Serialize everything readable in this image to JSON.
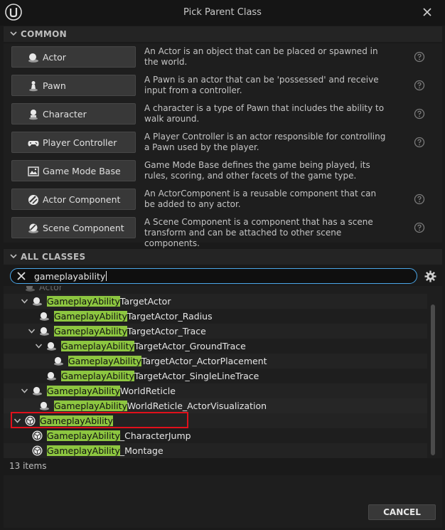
{
  "window": {
    "title": "Pick Parent Class"
  },
  "common": {
    "header": "COMMON",
    "items": [
      {
        "label": "Actor",
        "icon": "actor-icon",
        "description": "An Actor is an object that can be placed or spawned in the world.",
        "has_help": true
      },
      {
        "label": "Pawn",
        "icon": "pawn-icon",
        "description": "A Pawn is an actor that can be 'possessed' and receive input from a controller.",
        "has_help": true
      },
      {
        "label": "Character",
        "icon": "character-icon",
        "description": "A character is a type of Pawn that includes the ability to walk around.",
        "has_help": true
      },
      {
        "label": "Player Controller",
        "icon": "gamepad-icon",
        "description": "A Player Controller is an actor responsible for controlling a Pawn used by the player.",
        "has_help": true
      },
      {
        "label": "Game Mode Base",
        "icon": "game-mode-icon",
        "description": "Game Mode Base defines the game being played, its rules, scoring, and other facets of the game type.",
        "has_help": false
      },
      {
        "label": "Actor Component",
        "icon": "actor-component-icon",
        "description": "An ActorComponent is a reusable component that can be added to any actor.",
        "has_help": true
      },
      {
        "label": "Scene Component",
        "icon": "scene-component-icon",
        "description": "A Scene Component is a component that has a scene transform and can be attached to other scene components.",
        "has_help": true
      }
    ]
  },
  "all_classes": {
    "header": "ALL CLASSES",
    "search_value": "gameplayability",
    "tree": [
      {
        "match": "",
        "rest": "Actor",
        "icon": "actor-icon",
        "faded": true
      },
      {
        "match": "GameplayAbility",
        "rest": "TargetActor",
        "icon": "actor-icon",
        "expanded": true
      },
      {
        "match": "GameplayAbility",
        "rest": "TargetActor_Radius",
        "icon": "actor-icon"
      },
      {
        "match": "GameplayAbility",
        "rest": "TargetActor_Trace",
        "icon": "actor-icon",
        "expanded": true
      },
      {
        "match": "GameplayAbility",
        "rest": "TargetActor_GroundTrace",
        "icon": "actor-icon",
        "expanded": true
      },
      {
        "match": "GameplayAbility",
        "rest": "TargetActor_ActorPlacement",
        "icon": "actor-icon"
      },
      {
        "match": "GameplayAbility",
        "rest": "TargetActor_SingleLineTrace",
        "icon": "actor-icon"
      },
      {
        "match": "GameplayAbility",
        "rest": "WorldReticle",
        "icon": "actor-icon",
        "expanded": true
      },
      {
        "match": "GameplayAbility",
        "rest": "WorldReticle_ActorVisualization",
        "icon": "actor-icon"
      },
      {
        "match": "GameplayAbility",
        "rest": "",
        "icon": "object-icon",
        "expanded": true,
        "selected": true
      },
      {
        "match": "GameplayAbility",
        "rest": "_CharacterJump",
        "icon": "object-icon"
      },
      {
        "match": "GameplayAbility",
        "rest": "_Montage",
        "icon": "object-icon"
      }
    ],
    "count_label": "13 items"
  },
  "footer": {
    "cancel_label": "CANCEL"
  },
  "colors": {
    "highlight": "#8dc640",
    "selection_outline": "#e0101b",
    "search_focus": "#4aa6e8"
  }
}
